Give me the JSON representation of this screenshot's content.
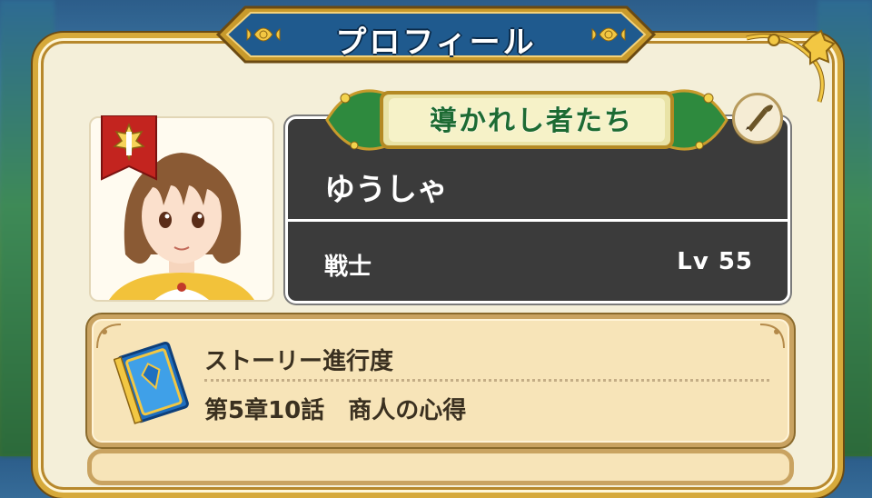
{
  "window": {
    "title": "プロフィール"
  },
  "profile": {
    "honor_title": "導かれし者たち",
    "name": "ゆうしゃ",
    "job": "戦士",
    "level": "Lv 55"
  },
  "story": {
    "heading": "ストーリー進行度",
    "value": "第5章10話　商人の心得"
  },
  "icons": {
    "class_emblem": "warrior-emblem-flag-icon",
    "edit": "quill-pen-icon",
    "story": "blue-book-icon"
  },
  "colors": {
    "panel_bg": "#f4efd9",
    "panel_border": "#d6a93a",
    "title_banner": "#1f5a8e",
    "name_box": "#3b3b3b",
    "honor_text": "#1d6b33",
    "story_bg": "#f7e4b8"
  }
}
